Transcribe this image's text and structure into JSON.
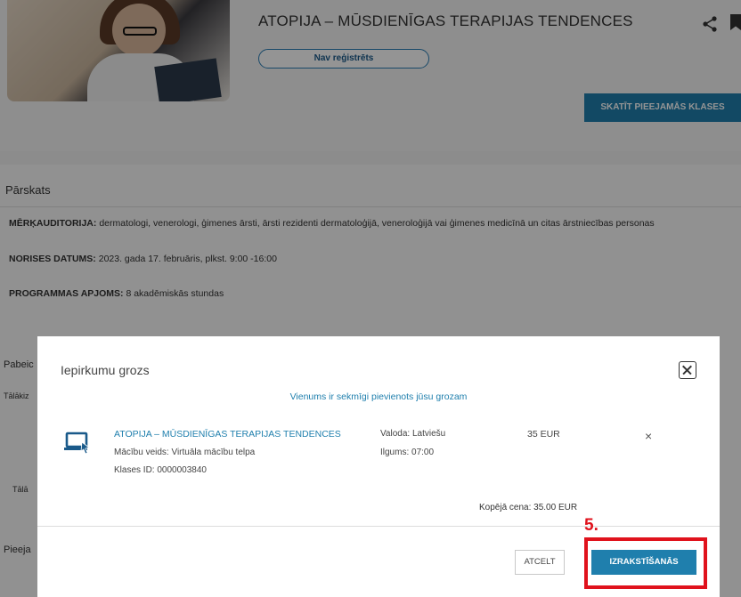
{
  "course": {
    "title": "ATOPIJA – MŪSDIENĪGAS TERAPIJAS TENDENCES",
    "status_pill": "Nav reģistrēts",
    "available_button": "SKATĪT PIEEJAMĀS KLASES"
  },
  "overview": {
    "heading": "Pārskats",
    "rows": [
      {
        "label": "MĒRĶAUDITORIJA:",
        "value": " dermatologi, venerologi, ģimenes ārsti, ārsti rezidenti dermatoloģijā, veneroloģijā vai ģimenes medicīnā un citas ārstniecības personas"
      },
      {
        "label": "NORISES DATUMS:",
        "value": " 2023. gada 17. februāris, plkst. 9:00 -16:00"
      },
      {
        "label": "PROGRAMMAS APJOMS:",
        "value": " 8 akadēmiskās stundas"
      }
    ],
    "side_labels": [
      "Pabeic",
      "Tālākiz",
      "Tālā",
      "Pieeja"
    ]
  },
  "modal": {
    "title": "Iepirkumu grozs",
    "success_message": "Vienums ir sekmīgi pievienots jūsu grozam",
    "item": {
      "name": "ATOPIJA – MŪSDIENĪGAS TERAPIJAS TENDENCES",
      "type": "Mācību veids: Virtuāla mācību telpa",
      "class_id": "Klases ID: 0000003840",
      "language": "Valoda: Latviešu",
      "duration": "Ilgums: 07:00",
      "price": "35 EUR",
      "remove": "×"
    },
    "total": "Kopējā cena: 35.00 EUR",
    "cancel_button": "ATCELT",
    "checkout_button": "IZRAKSTĪŠANĀS"
  },
  "annotation": {
    "step": "5."
  },
  "colors": {
    "accent": "#1f7fad",
    "highlight": "#e0121c"
  }
}
